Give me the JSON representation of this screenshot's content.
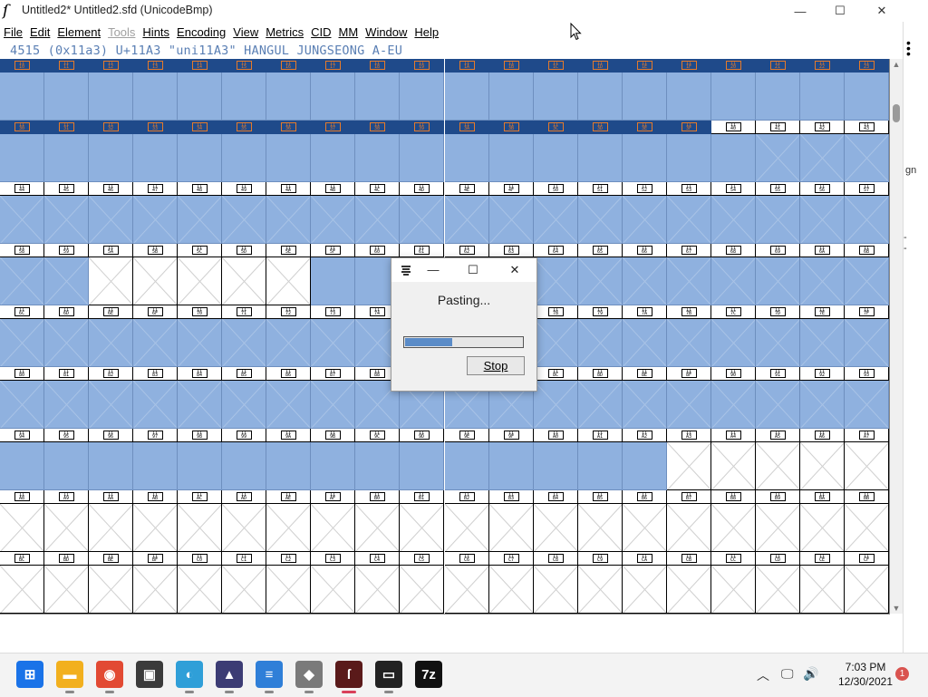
{
  "window": {
    "title": "Untitled2*  Untitled2.sfd (UnicodeBmp)",
    "app_icon": "fontforge-icon",
    "controls": {
      "minimize": "—",
      "maximize": "☐",
      "close": "✕"
    }
  },
  "menu": [
    {
      "label": "File",
      "disabled": false
    },
    {
      "label": "Edit",
      "disabled": false
    },
    {
      "label": "Element",
      "disabled": false
    },
    {
      "label": "Tools",
      "disabled": true
    },
    {
      "label": "Hints",
      "disabled": false
    },
    {
      "label": "Encoding",
      "disabled": false
    },
    {
      "label": "View",
      "disabled": false
    },
    {
      "label": "Metrics",
      "disabled": false
    },
    {
      "label": "CID",
      "disabled": false
    },
    {
      "label": "MM",
      "disabled": false
    },
    {
      "label": "Window",
      "disabled": false
    },
    {
      "label": "Help",
      "disabled": false
    }
  ],
  "info_line": "4515 (0x11a3) U+11A3 \"uni11A3\" HANGUL JUNGSEONG A-EU",
  "grid": {
    "columns": 20,
    "rows": [
      {
        "labels": [
          "11\n10",
          "11\n11",
          "11\n12",
          "11\n13",
          "11\n14",
          "11\n15",
          "11\n16",
          "11\n17",
          "11\n18",
          "11\n19",
          "11\n1A",
          "11\n1B",
          "11\n1C",
          "11\n1D",
          "11\n1E",
          "11\n1F",
          "11\n20",
          "11\n21",
          "11\n22",
          "11\n23"
        ],
        "sel": 20,
        "cells": "BBBBBBBBBBBBBBBBBBBB"
      },
      {
        "labels": [
          "11\n30",
          "11\n31",
          "11\n32",
          "11\n33",
          "11\n34",
          "11\n35",
          "11\n36",
          "11\n37",
          "11\n38",
          "11\n39",
          "11\n3A",
          "11\n3B",
          "11\n3C",
          "11\n3D",
          "11\n3E",
          "11\n3F",
          "11\n40",
          "11\n41",
          "11\n42",
          "11\n43"
        ],
        "sel": 16,
        "cells": "BBBBBBBBBBBBBBBBBXXX"
      },
      {
        "labels": [
          "11\n44",
          "11\n45",
          "11\n46",
          "11\n47",
          "11\n48",
          "11\n49",
          "11\n4A",
          "11\n4B",
          "11\n4C",
          "11\n4D",
          "11\n4E",
          "11\n4F",
          "11\n50",
          "11\n51",
          "11\n52",
          "11\n53",
          "11\n54",
          "11\n55",
          "11\n56",
          "11\n57"
        ],
        "sel": 0,
        "cells": "XXXXXXXXXXXXXXXXXXXX"
      },
      {
        "labels": [
          "11\n58",
          "11\n59",
          "11\n5A",
          "11\n5B",
          "11\n5C",
          "11\n5D",
          "11\n5E",
          "11\n5F",
          "11\n60",
          "11\n61",
          "11\n62",
          "11\n63",
          "11\n64",
          "11\n65",
          "11\n66",
          "11\n67",
          "11\n68",
          "11\n69",
          "11\n6A",
          "11\n6B"
        ],
        "sel": 0,
        "cells": "XXWWWWWBBBBBXXXXXXXX"
      },
      {
        "labels": [
          "11\n6C",
          "11\n6D",
          "11\n6E",
          "11\n6F",
          "11\n70",
          "11\n71",
          "11\n72",
          "11\n73",
          "11\n74",
          "11\n75",
          "11\n76",
          "11\n77",
          "11\n78",
          "11\n79",
          "11\n7A",
          "11\n7B",
          "11\n7C",
          "11\n7D",
          "11\n7E",
          "11\n7F"
        ],
        "sel": 0,
        "cells": "XXXXXXXXXXXXXXXXXXXX"
      },
      {
        "labels": [
          "11\n80",
          "11\n81",
          "11\n82",
          "11\n83",
          "11\n84",
          "11\n85",
          "11\n86",
          "11\n87",
          "11\n88",
          "11\n89",
          "11\n8A",
          "11\n8B",
          "11\n8C",
          "11\n8D",
          "11\n8E",
          "11\n8F",
          "11\n90",
          "11\n91",
          "11\n92",
          "11\n93"
        ],
        "sel": 0,
        "cells": "XXXXXXXXXXXXXXXXXXXX"
      },
      {
        "labels": [
          "11\n94",
          "11\n95",
          "11\n96",
          "11\n97",
          "11\n98",
          "11\n99",
          "11\n9A",
          "11\n9B",
          "11\n9C",
          "11\n9D",
          "11\n9E",
          "11\n9F",
          "11\nA0",
          "11\nA1",
          "11\nA2",
          "11\nA3",
          "11\nA4",
          "11\nA5",
          "11\nA6",
          "11\nA7"
        ],
        "sel": 0,
        "cells": "BBBBBBBBBBBBBBBWWWWW"
      },
      {
        "labels": [
          "11\nA8",
          "11\nA9",
          "11\nAA",
          "11\nAB",
          "11\nAC",
          "11\nAD",
          "11\nAE",
          "11\nAF",
          "11\nB0",
          "11\nB1",
          "11\nB2",
          "11\nB3",
          "11\nB4",
          "11\nB5",
          "11\nB6",
          "11\nB7",
          "11\nB8",
          "11\nB9",
          "11\nBA",
          "11\nBB"
        ],
        "sel": 0,
        "cells": "WWWWWWWWWWWWWWWWWWWW"
      },
      {
        "labels": [
          "11\nBC",
          "11\nBD",
          "11\nBE",
          "11\nBF",
          "11\nC0",
          "11\nC1",
          "11\nC2",
          "11\nC3",
          "11\nC4",
          "11\nC5",
          "11\nC6",
          "11\nC7",
          "11\nC8",
          "11\nC9",
          "11\nCA",
          "11\nCB",
          "11\nCC",
          "11\nCD",
          "11\nCE",
          "11\nCF"
        ],
        "sel": 0,
        "cells": "WWWWWWWWWWWWWWWWWWWW"
      }
    ]
  },
  "dialog": {
    "icon": "fontforge-icon",
    "message": "Pasting...",
    "progress": 0.4,
    "stop_label": "Stop"
  },
  "right_edge_text": "gn",
  "taskbar": {
    "apps": [
      {
        "name": "start-button",
        "icon": "windows-logo-icon",
        "bg": "#1a73e8"
      },
      {
        "name": "file-explorer-button",
        "icon": "folder-icon",
        "bg": "#f2b01e"
      },
      {
        "name": "chrome-button",
        "icon": "chrome-icon",
        "bg": "#e24a33"
      },
      {
        "name": "store-button",
        "icon": "store-icon",
        "bg": "#3b3b3b"
      },
      {
        "name": "edge-button",
        "icon": "edge-icon",
        "bg": "#2f9fd8"
      },
      {
        "name": "inkscape-button",
        "icon": "inkscape-icon",
        "bg": "#3c3c74"
      },
      {
        "name": "notepad-button",
        "icon": "notepad-icon",
        "bg": "#2f7fd8"
      },
      {
        "name": "app-button",
        "icon": "app-icon",
        "bg": "#7a7a7a"
      },
      {
        "name": "fontforge-button",
        "icon": "fontforge-icon",
        "bg": "#5a1a1a"
      },
      {
        "name": "terminal-button",
        "icon": "terminal-icon",
        "bg": "#222222"
      },
      {
        "name": "7zip-button",
        "icon": "7zip-icon",
        "bg": "#111111"
      }
    ],
    "clock_time": "7:03 PM",
    "clock_date": "12/30/2021",
    "notification_count": "1"
  }
}
